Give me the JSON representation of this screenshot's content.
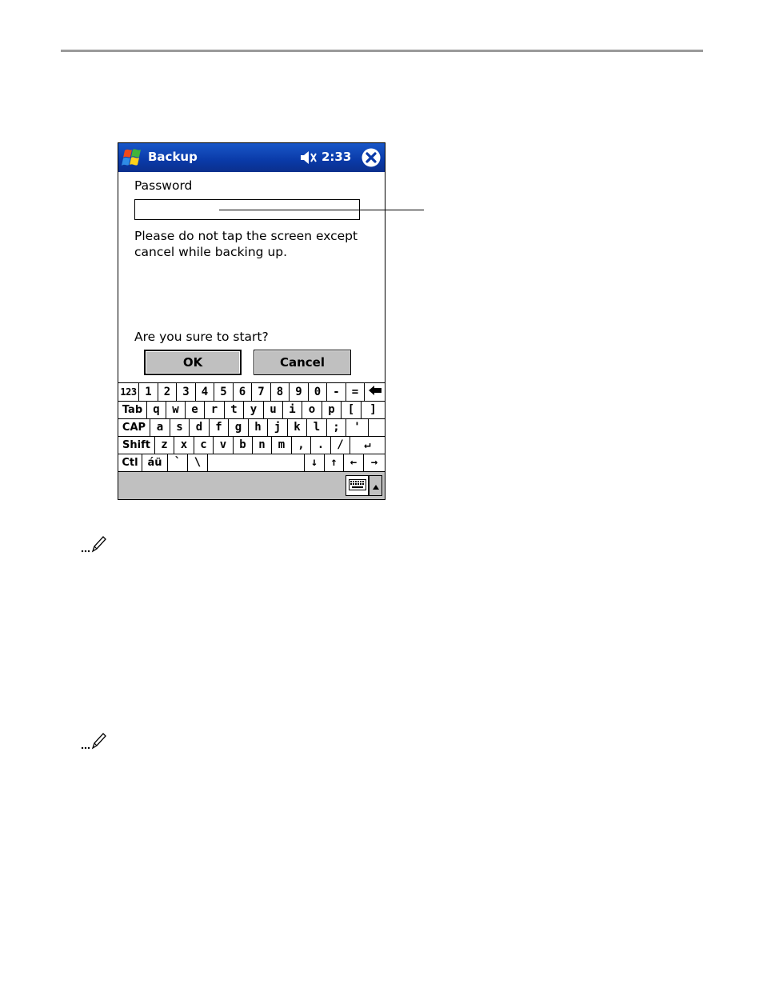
{
  "window": {
    "title": "Backup",
    "clock": "2:33"
  },
  "form": {
    "password_label": "Password",
    "password_value": "",
    "message": "Please do not tap the screen except cancel while backing up.",
    "confirm_text": "Are you sure to start?",
    "ok_label": "OK",
    "cancel_label": "Cancel"
  },
  "keyboard": {
    "rows": [
      [
        "123",
        "1",
        "2",
        "3",
        "4",
        "5",
        "6",
        "7",
        "8",
        "9",
        "0",
        "-",
        "=",
        "backspace"
      ],
      [
        "Tab",
        "q",
        "w",
        "e",
        "r",
        "t",
        "y",
        "u",
        "i",
        "o",
        "p",
        "[",
        "]"
      ],
      [
        "CAP",
        "a",
        "s",
        "d",
        "f",
        "g",
        "h",
        "j",
        "k",
        "l",
        ";",
        "'"
      ],
      [
        "Shift",
        "z",
        "x",
        "c",
        "v",
        "b",
        "n",
        "m",
        ",",
        ".",
        "/",
        "↵"
      ],
      [
        "Ctl",
        "áü",
        "`",
        "\\",
        " ",
        "↓",
        "↑",
        "←",
        "→"
      ]
    ]
  },
  "icons": {
    "start": "windows-flag-icon",
    "speaker": "speaker-muted-icon",
    "close": "close-circle-icon",
    "backspace": "backspace-arrow-icon",
    "keyboard": "keyboard-icon",
    "note": "pencil-note-icon"
  },
  "colors": {
    "titlebar": "#0a3aa8",
    "button_face": "#c0c0c0"
  }
}
